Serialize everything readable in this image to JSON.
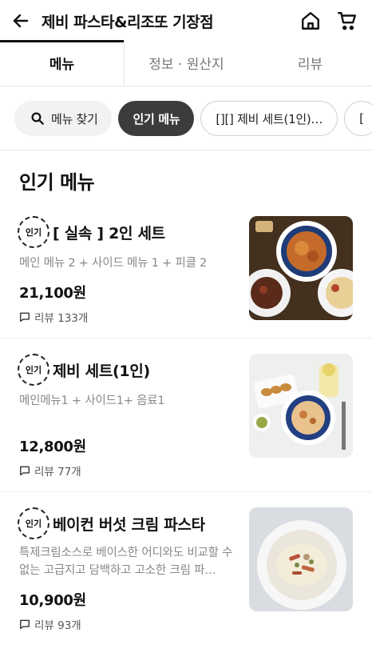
{
  "header": {
    "title": "제비 파스타&리조또 기장점",
    "back_icon": "arrow-left-icon",
    "home_icon": "home-icon",
    "cart_icon": "cart-icon"
  },
  "tabs": [
    {
      "label": "메뉴",
      "active": true
    },
    {
      "label": "정보 · 원산지",
      "active": false
    },
    {
      "label": "리뷰",
      "active": false
    }
  ],
  "chips": {
    "search_label": "메뉴 찾기",
    "items": [
      "인기 메뉴",
      "[][] 제비 세트(1인)…",
      "["
    ]
  },
  "section_title": "인기 메뉴",
  "badge_label": "인기",
  "menu_items": [
    {
      "name": "[ 실속 ] 2인 세트",
      "description": "메인 메뉴 2 + 사이드 메뉴 1 + 피클 2",
      "price": "21,100원",
      "review": "리뷰 133개"
    },
    {
      "name": "제비 세트(1인)",
      "description": "메인메뉴1 + 사이드1+ 음료1",
      "price": "12,800원",
      "review": "리뷰 77개"
    },
    {
      "name": "베이컨 버섯 크림 파스타",
      "description": "특제크림소스로 베이스한 어디와도 비교할 수 없는 고급지고 담백하고 고소한 크림 파…",
      "price": "10,900원",
      "review": "리뷰 93개"
    }
  ],
  "colors": {
    "active_chip_bg": "#3c3c3c",
    "text": "#111111",
    "muted": "#888888"
  }
}
